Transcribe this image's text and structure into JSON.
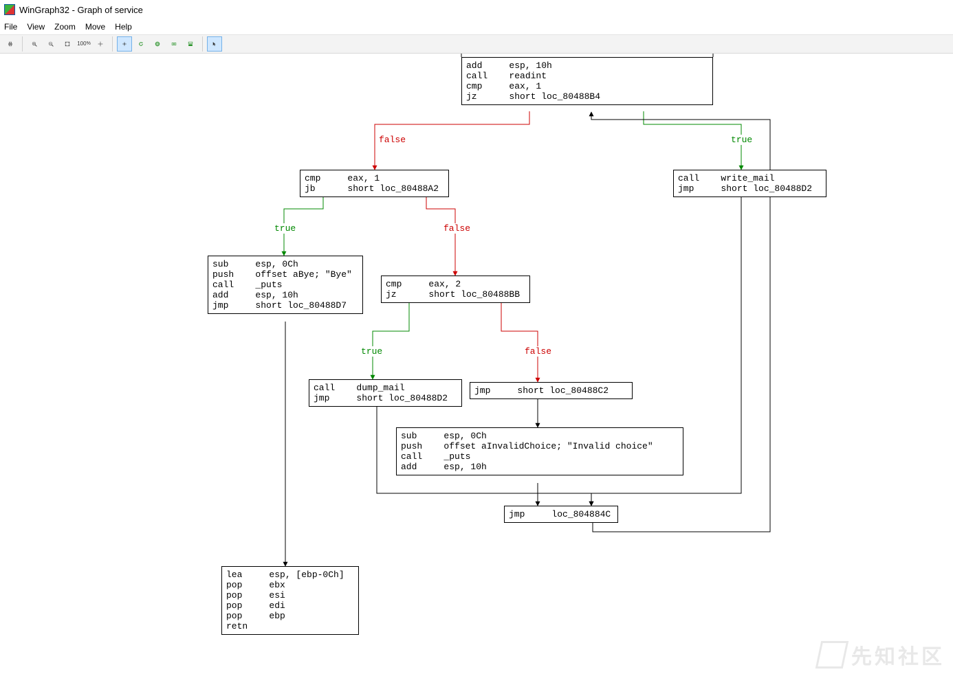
{
  "title": "WinGraph32 - Graph of service",
  "menu": {
    "file": "File",
    "view": "View",
    "zoom": "Zoom",
    "move": "Move",
    "help": "Help"
  },
  "toolbar": {
    "print": "print-icon",
    "zoom_in": "zoom-in-icon",
    "zoom_out": "zoom-out-icon",
    "zoom_fit": "zoom-fit-icon",
    "zoom_100": "100",
    "center": "center-icon",
    "crosshair": "crosshair-icon",
    "refresh_ccw": "refresh-ccw-icon",
    "globe": "globe-icon",
    "layout_a": "layout-a-icon",
    "layout_b": "layout-b-icon",
    "cursor": "cursor-icon"
  },
  "edge_labels": {
    "true": "true",
    "false": "false"
  },
  "nodes": {
    "n1": "add     esp, 10h\ncall    readint\ncmp     eax, 1\njz      short loc_80488B4",
    "n2": "cmp     eax, 1\njb      short loc_80488A2",
    "n3": "call    write_mail\njmp     short loc_80488D2",
    "n4": "sub     esp, 0Ch\npush    offset aBye; \"Bye\"\ncall    _puts\nadd     esp, 10h\njmp     short loc_80488D7",
    "n5": "cmp     eax, 2\njz      short loc_80488BB",
    "n6": "call    dump_mail\njmp     short loc_80488D2",
    "n7": "jmp     short loc_80488C2",
    "n8": "sub     esp, 0Ch\npush    offset aInvalidChoice; \"Invalid choice\"\ncall    _puts\nadd     esp, 10h",
    "n9": "jmp     loc_804884C",
    "n10": "lea     esp, [ebp-0Ch]\npop     ebx\npop     esi\npop     edi\npop     ebp\nretn"
  },
  "watermark": "先知社区"
}
